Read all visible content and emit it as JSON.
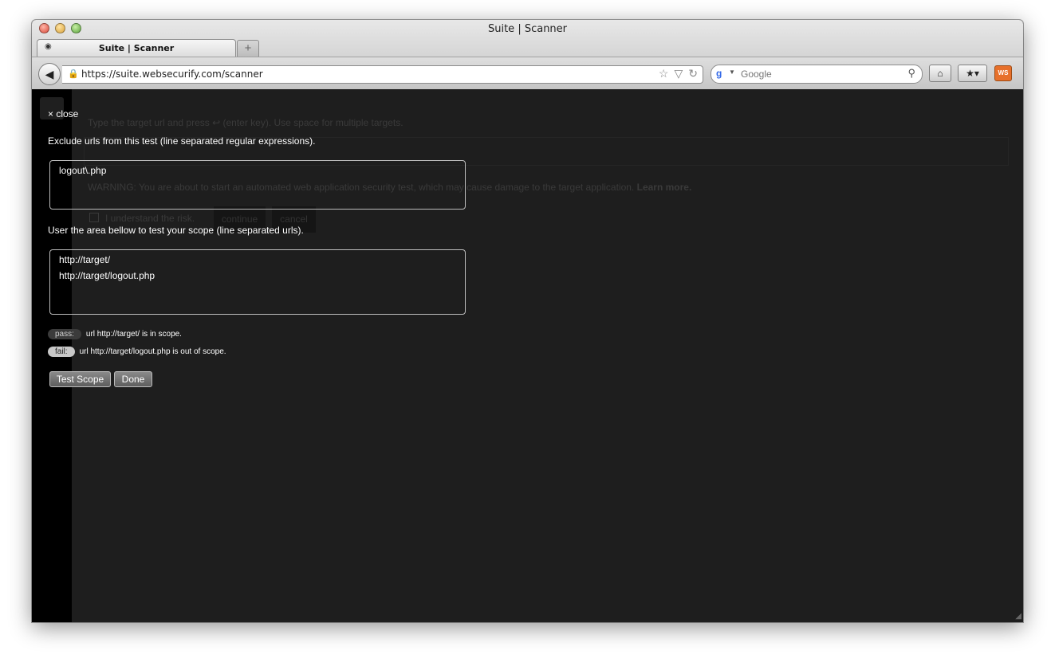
{
  "window": {
    "title": "Suite | Scanner"
  },
  "tab": {
    "title": "Suite | Scanner",
    "new_tab_glyph": "+"
  },
  "navbar": {
    "url": "https://suite.websecurify.com/scanner",
    "search_placeholder": "Google",
    "extension_label": "WS"
  },
  "background": {
    "instruction": "Type the target url and press ↩ (enter key). Use space for multiple targets.",
    "warning": "WARNING: You are about to start an automated web application security test, which may cause damage to the target application.",
    "learn_more": "Learn more.",
    "understand": "I understand the risk.",
    "continue_label": "continue",
    "cancel_label": "cancel"
  },
  "overlay": {
    "close_label": "× close",
    "exclude_label": "Exclude urls from this test (line separated regular expressions).",
    "exclude_lines": [
      "logout\\.php"
    ],
    "scope_label": "User the area bellow to test your scope (line separated urls).",
    "scope_lines": [
      "http://target/",
      "http://target/logout.php"
    ],
    "results": [
      {
        "badge": "pass:",
        "text": "url http://target/ is in scope."
      },
      {
        "badge": "fail:",
        "text": "url http://target/logout.php is out of scope."
      }
    ],
    "test_scope_label": "Test Scope",
    "done_label": "Done"
  }
}
